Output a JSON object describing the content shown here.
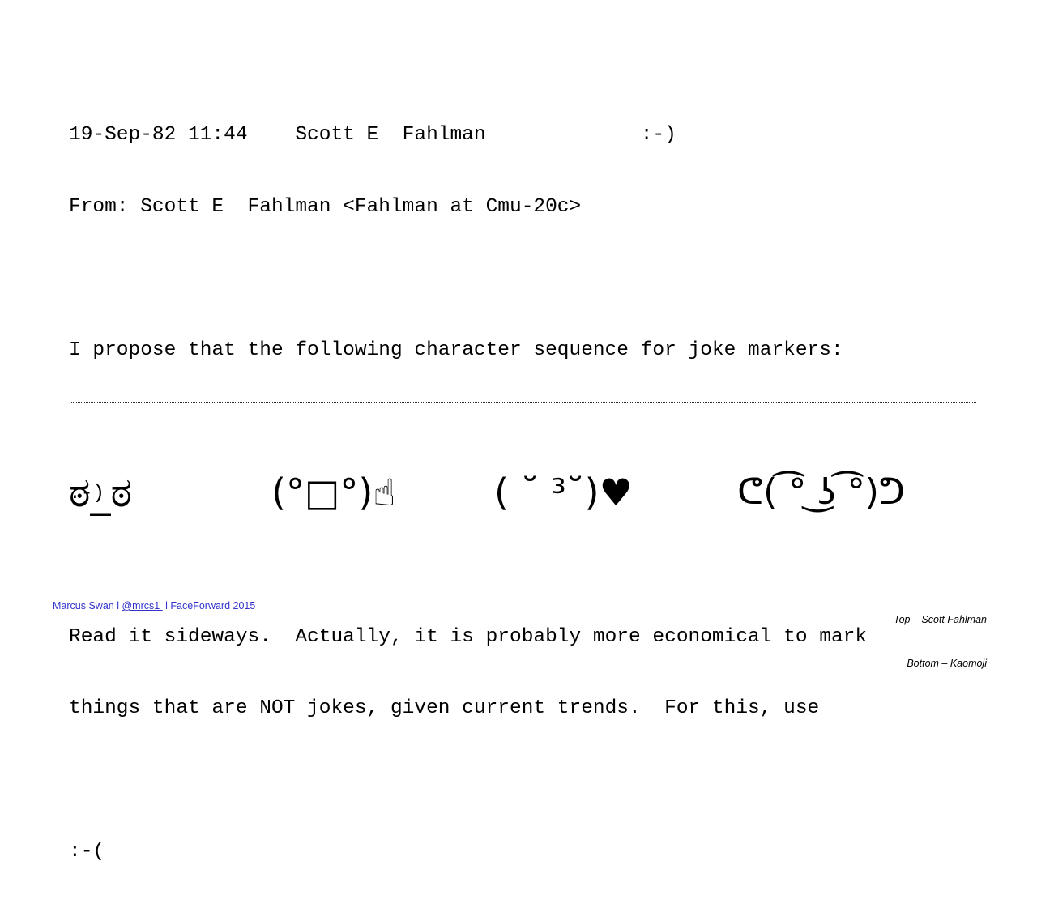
{
  "slide": {
    "background_color": "#ffffff",
    "text_color": "#000000"
  },
  "email": {
    "header_line": "19-Sep-82 11:44    Scott E  Fahlman             :-)",
    "from_line": "From: Scott E  Fahlman <Fahlman at Cmu-20c>",
    "proposal_line": "I propose that the following character sequence for joke markers:",
    "smiley": ":-)",
    "body_line_1": "Read it sideways.  Actually, it is probably more economical to mark",
    "body_line_2": "things that are NOT jokes, given current trends.  For this, use",
    "frowny": ":-("
  },
  "divider": {
    "style": "dotted",
    "color": "#2b2b2b"
  },
  "kaomoji": [
    {
      "name": "look-of-disapproval",
      "glyph": "ಠ_ಠ"
    },
    {
      "name": "table-flip-surprise",
      "glyph": "(°□°)☝"
    },
    {
      "name": "kissing-heart",
      "glyph": "( ˘ ³˘)♥"
    },
    {
      "name": "lenny-face-flex",
      "glyph": "ᕦ( ͡° ͜ʖ ͡°)ᕤ"
    }
  ],
  "footer": {
    "author": "Marcus Swan",
    "separator_1": " l ",
    "handle": "@mrcs1 ",
    "separator_2": " l ",
    "event": "FaceForward 2015",
    "color": "#3333cc"
  },
  "attribution": {
    "top_credit": "Top – Scott Fahlman",
    "bottom_credit": "Bottom – Kaomoji"
  }
}
